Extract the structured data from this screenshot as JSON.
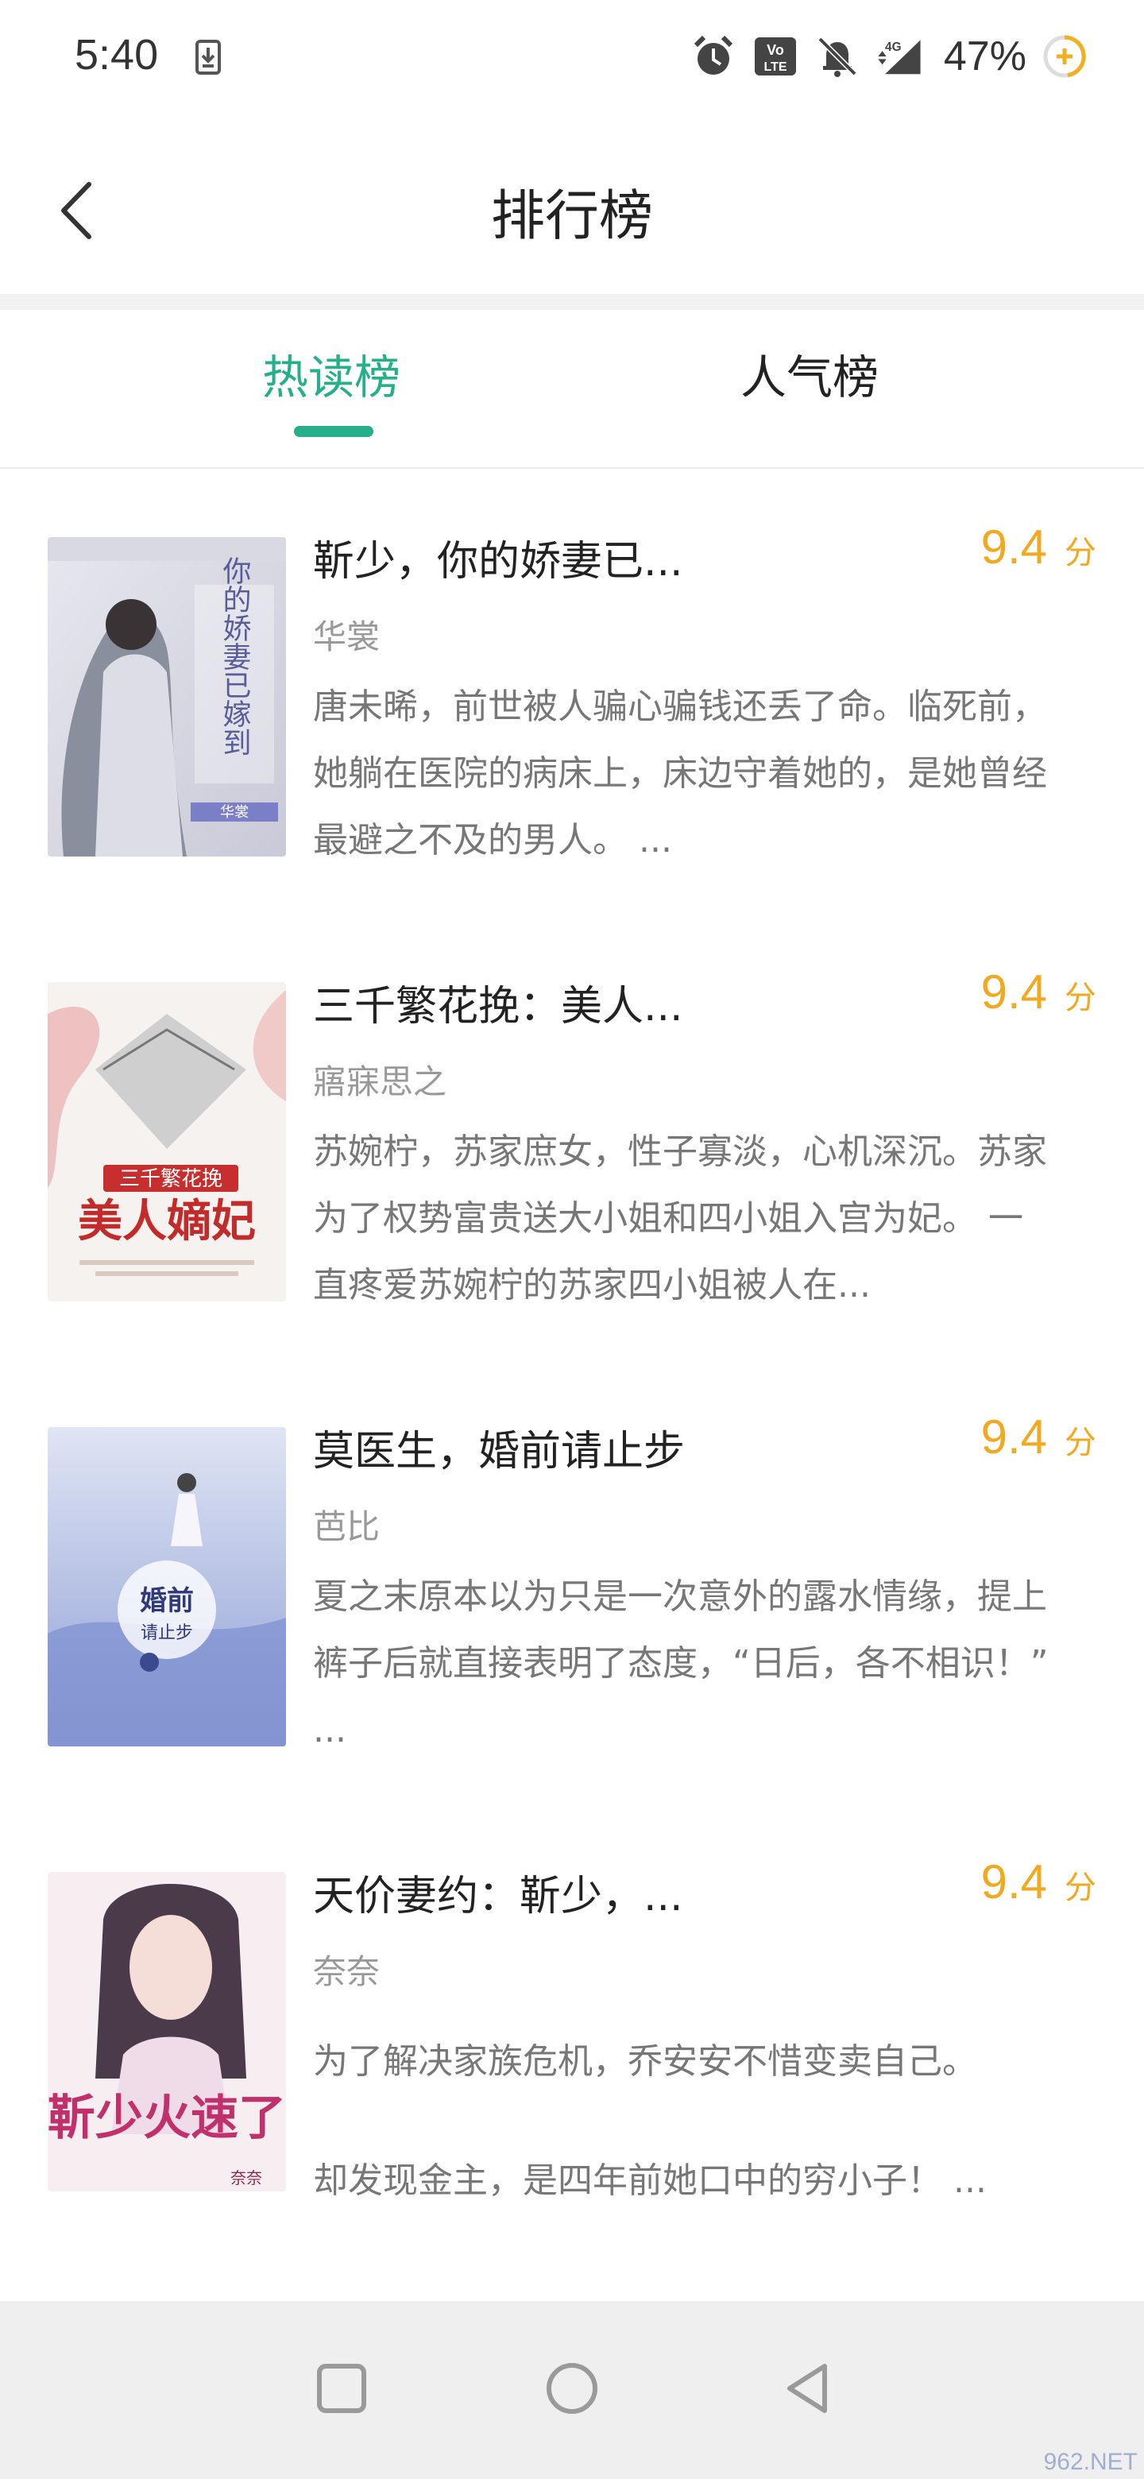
{
  "status_bar": {
    "time": "5:40",
    "network": "4G",
    "battery": "47%",
    "icons": [
      "download-icon",
      "alarm-icon",
      "volte-icon",
      "mute-icon",
      "signal-icon",
      "battery-icon"
    ]
  },
  "header": {
    "title": "排行榜",
    "back_icon": "chevron-left-icon"
  },
  "tabs": [
    {
      "label": "热读榜",
      "active": true
    },
    {
      "label": "人气榜",
      "active": false
    }
  ],
  "colors": {
    "accent": "#25b08a",
    "score": "#f2a81f"
  },
  "books": [
    {
      "title": "靳少，你的娇妻已...",
      "author": "华裳",
      "score": "9.4",
      "score_unit": "分",
      "desc": "唐未晞，前世被人骗心骗钱还丢了命。临死前，她躺在医院的病床上，床边守着她的，是她曾经最避之不及的男人。 ...",
      "cover_text": "你的娇妻已嫁到",
      "cover_sub": "华裳"
    },
    {
      "title": "三千繁花挽：美人...",
      "author": "寤寐思之",
      "score": "9.4",
      "score_unit": "分",
      "desc": "苏婉柠，苏家庶女，性子寡淡，心机深沉。苏家为了权势富贵送大小姐和四小姐入宫为妃。 一直疼爱苏婉柠的苏家四小姐被人在...",
      "cover_text": "美人嫡妃",
      "cover_sub": "三千繁花挽"
    },
    {
      "title": "莫医生，婚前请止步",
      "author": "芭比",
      "score": "9.4",
      "score_unit": "分",
      "desc": "夏之末原本以为只是一次意外的露水情缘，提上裤子后就直接表明了态度，“日后，各不相识！” ...",
      "cover_text": "婚前",
      "cover_sub": "请止步"
    },
    {
      "title": "天价妻约：靳少，...",
      "author": "奈奈",
      "score": "9.4",
      "score_unit": "分",
      "desc": "为了解决家族危机，乔安安不惜变卖自己。\n却发现金主，是四年前她口中的穷小子！ ...",
      "cover_text": "靳少火速了",
      "cover_sub": "奈奈"
    }
  ],
  "nav": {
    "recents": "square-nav-icon",
    "home": "circle-nav-icon",
    "back": "triangle-back-nav-icon"
  },
  "watermark": "962.NET"
}
